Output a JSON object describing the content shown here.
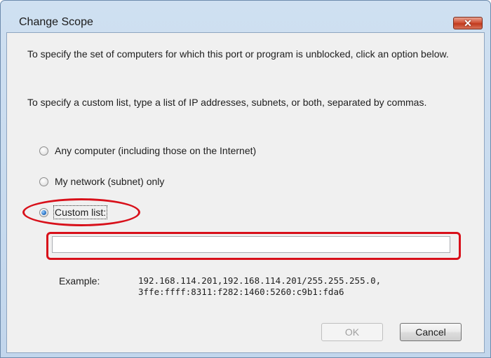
{
  "window": {
    "title": "Change Scope",
    "close_glyph": "✕"
  },
  "instructions": {
    "line1": "To specify the set of computers for which this port or program is unblocked, click an option below.",
    "line2": "To specify a custom list, type a list of IP addresses, subnets, or both, separated by commas."
  },
  "options": [
    {
      "label": "Any computer (including those on the Internet)",
      "checked": false
    },
    {
      "label": "My network (subnet) only",
      "checked": false
    },
    {
      "label": "Custom list:",
      "checked": true
    }
  ],
  "custom_list": {
    "value": "",
    "placeholder": ""
  },
  "example": {
    "label": "Example:",
    "line1": "192.168.114.201,192.168.114.201/255.255.255.0,",
    "line2": "3ffe:ffff:8311:f282:1460:5260:c9b1:fda6"
  },
  "buttons": {
    "ok": "OK",
    "cancel": "Cancel"
  },
  "colors": {
    "annotation": "#d8101a",
    "frame": "#c2d6ec",
    "client": "#f0f0f0"
  }
}
